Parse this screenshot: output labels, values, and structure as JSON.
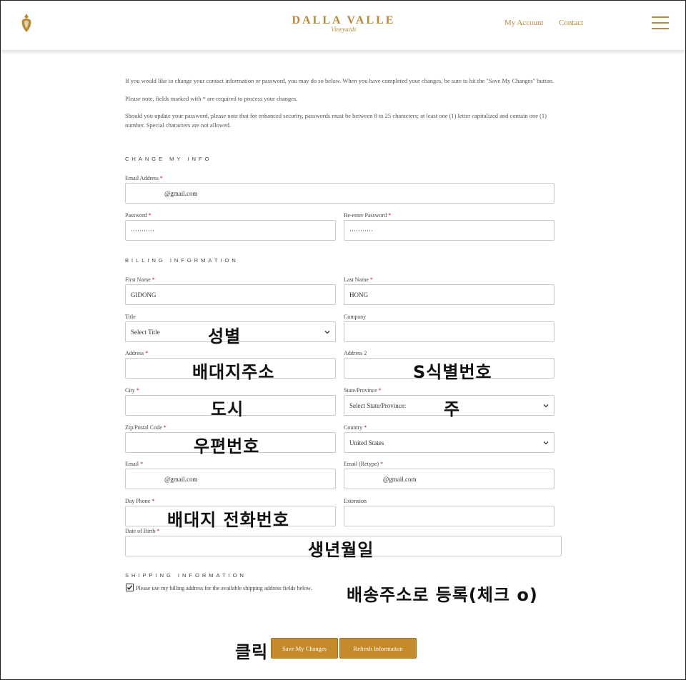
{
  "header": {
    "brand_name": "DALLA VALLE",
    "brand_sub": "Vineyards",
    "my_account": "My Account",
    "contact": "Contact"
  },
  "intro": {
    "p1": "If you would like to change your contact information or password, you may do so below. When you have completed your changes, be sure to hit the \"Save My Changes\" button.",
    "p2": "Please note, fields marked with * are required to process your changes.",
    "p3": "Should you update your password, please note that for enhanced security, passwords must be between 8 to 25 characters; at least one (1) letter capitalized and contain one (1) number. Special characters are not allowed."
  },
  "sections": {
    "change_info": "CHANGE MY INFO",
    "billing": "BILLING INFORMATION",
    "shipping": "SHIPPING INFORMATION"
  },
  "fields": {
    "email_address": {
      "label": "Email Address",
      "value": "@gmail.com"
    },
    "password": {
      "label": "Password",
      "value": "···········"
    },
    "reenter_password": {
      "label": "Re-enter Password",
      "value": "···········"
    },
    "first_name": {
      "label": "First Name",
      "value": "GIDONG"
    },
    "last_name": {
      "label": "Last Name",
      "value": "HONG"
    },
    "title": {
      "label": "Title",
      "value": "Select Title"
    },
    "company": {
      "label": "Company",
      "value": ""
    },
    "address": {
      "label": "Address",
      "value": ""
    },
    "address2": {
      "label": "Address 2",
      "value": ""
    },
    "city": {
      "label": "City",
      "value": ""
    },
    "state": {
      "label": "State/Province",
      "value": "Select State/Province:"
    },
    "zip": {
      "label": "Zip/Postal Code",
      "value": ""
    },
    "country": {
      "label": "Country",
      "value": "United States"
    },
    "email": {
      "label": "Email",
      "value": "@gmail.com"
    },
    "email_retype": {
      "label": "Email (Retype)",
      "value": "@gmail.com"
    },
    "day_phone": {
      "label": "Day Phone",
      "value": ""
    },
    "extension": {
      "label": "Extension",
      "value": ""
    },
    "dob": {
      "label": "Date of Birth",
      "value": ""
    }
  },
  "required_mark": "*",
  "shipping_checkbox": {
    "label": "Please use my billing address for the available shipping address fields below.",
    "checked": true
  },
  "buttons": {
    "save": "Save My Changes",
    "refresh": "Refresh Information"
  },
  "annotations": {
    "title": "성별",
    "address": "배대지주소",
    "address2": "S식별번호",
    "city": "도시",
    "state": "주",
    "zip": "우편번호",
    "phone": "배대지 전화번호",
    "dob": "생년월일",
    "shipping": "배송주소로 등록(체크 o)",
    "click": "클릭"
  },
  "colors": {
    "accent": "#b8893a",
    "button": "#c58a2c",
    "required": "#b02020"
  }
}
